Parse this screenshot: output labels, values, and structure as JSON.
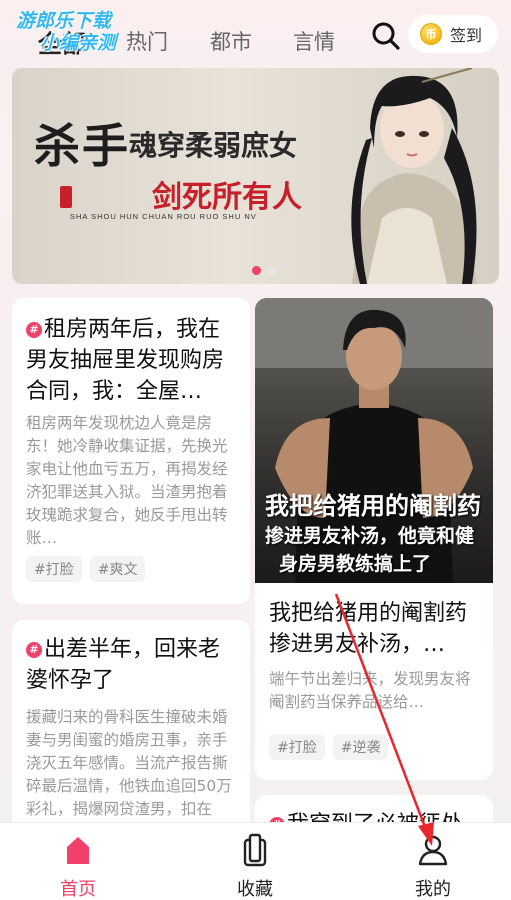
{
  "watermark": {
    "line1": "游郎乐下载",
    "line2": "小编亲测"
  },
  "header": {
    "tabs": [
      {
        "label": "全部"
      },
      {
        "label": "热门"
      },
      {
        "label": "都市"
      },
      {
        "label": "言情"
      }
    ],
    "active_tab": 0,
    "signin_label": "签到",
    "coin_glyph": "币"
  },
  "banner": {
    "big_text": "杀手",
    "mid_text": "魂穿柔弱庶女",
    "red_text": "剑死所有人",
    "pinyin": "SHA SHOU    HUN CHUAN ROU RUO SHU NV",
    "active_dot": 0,
    "dot_count": 2
  },
  "cards": [
    {
      "title": "租房两年后，我在男友抽屉里发现购房合同，我：全屋…",
      "desc": "租房两年发现枕边人竟是房东！她冷静收集证据，先换光家电让他血亏五万，再揭发经济犯罪送其入狱。当渣男抱着玫瑰跪求复合，她反手甩出转账…",
      "tags": [
        "#打脸",
        "#爽文"
      ]
    },
    {
      "cover_line1": "我把给猪用的阉割药",
      "cover_line2": "掺进男友补汤，他竟和健",
      "cover_line3": "身房男教练搞上了",
      "title": "我把给猪用的阉割药掺进男友补汤，…",
      "desc": "端午节出差归来，发现男友将阉割药当保养品送给…",
      "tags": [
        "#打脸",
        "#逆袭"
      ]
    },
    {
      "title": "出差半年，回来老婆怀孕了",
      "desc": "援藏归来的骨科医生撞破未婚妻与男闺蜜的婚房丑事，亲手浇灭五年感情。当流产报告撕碎最后温情，他铁血追回50万彩礼，揭爆网贷渣男，扣在"
    },
    {
      "title": "我穿到了必被惩处"
    }
  ],
  "bottom_nav": {
    "items": [
      {
        "label": "首页",
        "icon": "home-icon"
      },
      {
        "label": "收藏",
        "icon": "bookshelf-icon"
      },
      {
        "label": "我的",
        "icon": "profile-icon"
      }
    ],
    "active": 0
  },
  "colors": {
    "accent": "#f24168",
    "annotation_arrow": "#e8262c"
  }
}
